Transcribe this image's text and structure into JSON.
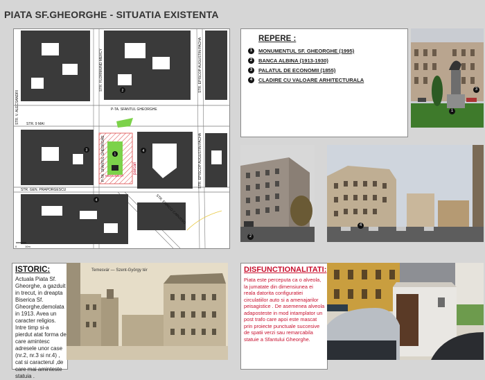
{
  "title": "PIATA SF.GHEORGHE - SITUATIA EXISTENTA",
  "map": {
    "street_labels": {
      "alecsandri": "STR. V. ALECSANDRI",
      "mercy": "STR. FLORIMUND MERCY",
      "pacha_top": "STR. EPISCOP AUGUSTIN PACHA",
      "pta_gheorghe": "P-TA. SFANTUL GHEORGHE",
      "mai": "STR. 9 MAI",
      "pta_gheorghe_vertical": "P-TA. SFANTUL GHEORGHE",
      "pacha_bottom": "STR. EPISCOP AUGUSTIN PACHA",
      "praporgescu": "STR. GEN. PRAPORGESCU",
      "caragiale": "STR. ENRICO CARUSSO"
    },
    "parcari": "parcari",
    "monument_label": "MONUMENT",
    "scale_zero": "0",
    "scale_end": "10m",
    "markers": [
      "1",
      "2",
      "3",
      "4"
    ]
  },
  "repere": {
    "title": "REPERE  :",
    "items": [
      {
        "num": "1",
        "label": "MONUMENTUL SF. GHEORGHE (1995)"
      },
      {
        "num": "2",
        "label": "BANCA ALBINA (1913-1930)"
      },
      {
        "num": "3",
        "label": "PALATUL DE ECONOMII (1855)"
      },
      {
        "num": "4",
        "label": "CLADIRE CU VALOARE  ARHITECTURALA"
      }
    ]
  },
  "photo_markers": {
    "p1_a": "1",
    "p1_b": "3",
    "p2": "2",
    "p3": "4"
  },
  "istoric": {
    "title": "ISTORIC:",
    "text": "Actuala Piata Sf. Gheorghe,  a gazduit in trecut, in dreapta Biserica Sf. Gheorghe,demolata in 1913. Avea un caracter religios. Intre timp si-a pierdut atat forma de care amintesc adresele unor case (nr.2, nr.3 si nr.4) , cat si caracterul ,de care mai aminteste statuia ."
  },
  "postcard_caption": "Temesvár — Szent-György tér",
  "disfunctionalitati": {
    "title": "DISFUNCTIONALITATI:",
    "text": "Piata este perceputa ca o alveola, la jumatate din dimensiunea ei reala datorita configuratiei circulatiilor auto si a amenajarilor peisagistice . De asemenea alveola adaposteste in mod intamplator un post trafo care apoi este mascat prin proiecte punctuale succesive de spatii verzi sau remarcabila statuie a Sfantului Gheorghe."
  },
  "colors": {
    "background": "#d6d6d6",
    "building": "#3a3a3a",
    "green": "#7cd24a",
    "red": "#c8102e"
  }
}
